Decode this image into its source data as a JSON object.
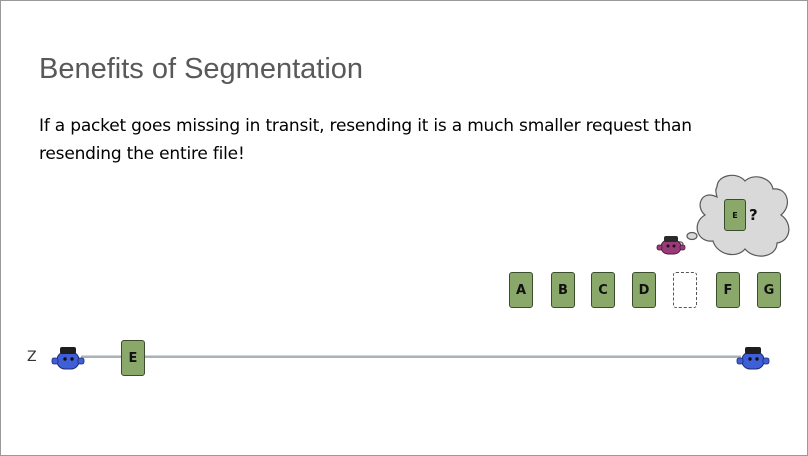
{
  "slide": {
    "title": "Benefits of Segmentation",
    "body": "If a packet goes missing in transit, resending it is a much smaller request than resending the entire file!",
    "node_label": "Z",
    "in_transit_packet": "E",
    "received_packets": [
      "A",
      "B",
      "C",
      "D",
      "",
      "F",
      "G"
    ],
    "missing_index": 4,
    "thought": {
      "packet": "E",
      "mark": "?"
    }
  },
  "colors": {
    "packet_fill": "#8aa86a",
    "packet_border": "#3c4d2e",
    "link_line": "#a9b1b9",
    "sender_robot": "#3f5fd8",
    "receiver_robot": "#3f5fd8",
    "thinking_robot": "#9b3a7a"
  },
  "icons": {
    "sender": "sender-robot-icon",
    "receiver": "receiver-robot-icon",
    "thinker": "thinking-robot-icon",
    "thought_bubble": "thought-cloud-icon"
  }
}
